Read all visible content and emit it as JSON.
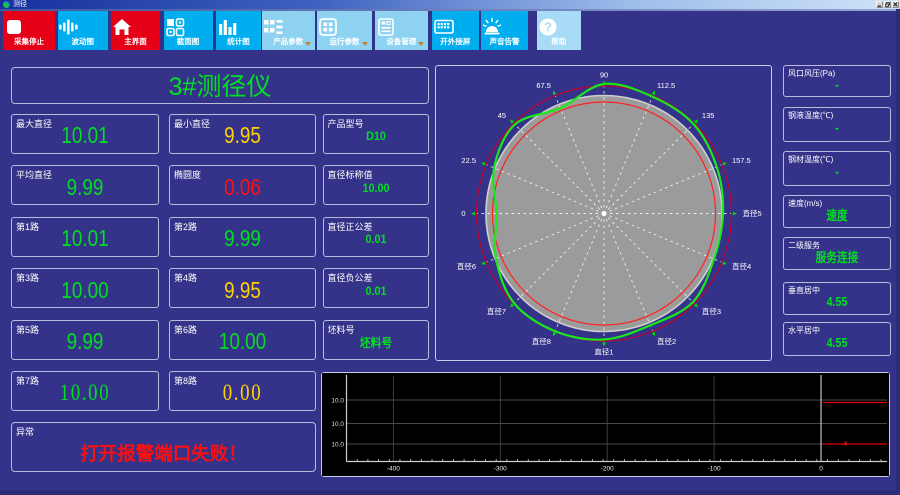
{
  "window": {
    "title": "测径",
    "controls": {
      "minimize": "_",
      "restore": "❐",
      "close": "✕"
    }
  },
  "toolbar": {
    "buttons": [
      {
        "label": "采集停止",
        "icon": "stop-icon",
        "style": "red"
      },
      {
        "label": "波动图",
        "icon": "wave-icon",
        "style": "cyan"
      },
      {
        "label": "主界面",
        "icon": "home-icon",
        "style": "red"
      },
      {
        "label": "截面图",
        "icon": "sections-icon",
        "style": "cyan"
      },
      {
        "label": "统计图",
        "icon": "barchart-icon",
        "style": "cyan"
      },
      {
        "label": "产品参数",
        "icon": "list-icon",
        "style": "pale",
        "dropdown": true
      },
      {
        "label": "运行参数",
        "icon": "grid-icon",
        "style": "pale",
        "dropdown": true
      },
      {
        "label": "设备管理",
        "icon": "device-icon",
        "style": "pale",
        "dropdown": true
      },
      {
        "label": "开外接屏",
        "icon": "monitor-icon",
        "style": "cyan"
      },
      {
        "label": "声音告警",
        "icon": "alarm-icon",
        "style": "cyan"
      },
      {
        "label": "帮助",
        "icon": "help-icon",
        "style": "pale2"
      }
    ],
    "dropdown_color": "#c2812e"
  },
  "gauge": {
    "title": "3#测径仪"
  },
  "measurements": [
    {
      "label": "最大直径",
      "value": "10.01",
      "color": "green"
    },
    {
      "label": "最小直径",
      "value": "9.95",
      "color": "yellow"
    },
    {
      "label": "平均直径",
      "value": "9.99",
      "color": "green"
    },
    {
      "label": "椭圆度",
      "value": "0.06",
      "color": "red"
    },
    {
      "label": "第1路",
      "value": "10.01",
      "color": "green"
    },
    {
      "label": "第2路",
      "value": "9.99",
      "color": "green"
    },
    {
      "label": "第3路",
      "value": "10.00",
      "color": "green"
    },
    {
      "label": "第4路",
      "value": "9.95",
      "color": "yellow"
    },
    {
      "label": "第5路",
      "value": "9.99",
      "color": "green"
    },
    {
      "label": "第6路",
      "value": "10.00",
      "color": "green"
    },
    {
      "label": "第7路",
      "value": "10.00",
      "color": "green",
      "serif": true
    },
    {
      "label": "第8路",
      "value": "0.00",
      "color": "yellow",
      "serif": true
    }
  ],
  "parameters": [
    {
      "label": "产品型号",
      "value": "D10"
    },
    {
      "label": "直径标称值",
      "value": "10.00"
    },
    {
      "label": "直径正公差",
      "value": "0.01"
    },
    {
      "label": "直径负公差",
      "value": "0.01"
    },
    {
      "label": "坯料号",
      "value": "坯料号"
    }
  ],
  "alarm": {
    "label": "异常",
    "value": "打开报警端口失败！"
  },
  "sidebar": [
    {
      "label": "风口风压(Pa)",
      "value": "-"
    },
    {
      "label": "钢液温度(℃)",
      "value": "-"
    },
    {
      "label": "钢材温度(℃)",
      "value": "-"
    },
    {
      "label": "速度(m/s)",
      "value": "速度"
    },
    {
      "label": "二级服务",
      "value": "服务连接"
    },
    {
      "label": "垂直居中",
      "value": "4.55"
    },
    {
      "label": "水平居中",
      "value": "4.55"
    }
  ],
  "colors": {
    "background": "#32328a",
    "card_border": "#b6bdda",
    "value_green": "#00df20",
    "value_yellow": "#ffd200",
    "value_red": "#ff1111",
    "button_red": "#e60017",
    "button_cyan": "#00aeef",
    "button_pale": "#8ed2f2"
  },
  "chart_data": [
    {
      "type": "polar-profile",
      "description": "cross-section profile of measured bar vs nominal circle",
      "angle_step_deg": 22.5,
      "spoke_labels": [
        {
          "angle_deg": 180,
          "text": "0"
        },
        {
          "angle_deg": 157.5,
          "text": "22.5"
        },
        {
          "angle_deg": 135,
          "text": "45"
        },
        {
          "angle_deg": 112.5,
          "text": "67.5"
        },
        {
          "angle_deg": 90,
          "text": "90"
        },
        {
          "angle_deg": 67.5,
          "text": "112.5"
        },
        {
          "angle_deg": 45,
          "text": "135"
        },
        {
          "angle_deg": 22.5,
          "text": "157.5"
        },
        {
          "angle_deg": 0,
          "text": "直径5"
        },
        {
          "angle_deg": 337.5,
          "text": "直径4"
        },
        {
          "angle_deg": 315,
          "text": "直径3"
        },
        {
          "angle_deg": 292.5,
          "text": "直径2"
        },
        {
          "angle_deg": 270,
          "text": "直径1"
        },
        {
          "angle_deg": 247.5,
          "text": "直径8"
        },
        {
          "angle_deg": 225,
          "text": "直径7"
        },
        {
          "angle_deg": 202.5,
          "text": "直径6"
        }
      ],
      "rings": [
        {
          "name": "section-fill",
          "radius": 118,
          "fill": "#9b9b9b",
          "stroke": "#cfcfcf"
        },
        {
          "name": "tolerance-inner",
          "radius": 111.5,
          "stroke": "#ff2222"
        },
        {
          "name": "tolerance-outer",
          "radius": 127.5,
          "stroke": "#c00030"
        }
      ],
      "profile": {
        "angles_deg": [
          0,
          22.5,
          45,
          67.5,
          90,
          112.5,
          135,
          157.5,
          180,
          202.5,
          225,
          247.5,
          270,
          292.5,
          315,
          337.5
        ],
        "radii": [
          119,
          122,
          126.5,
          126.5,
          129.5,
          114,
          126,
          119,
          107.5,
          117,
          127,
          127.5,
          126,
          121,
          125.5,
          119
        ],
        "color": "#1ae81a"
      },
      "spoke_color": "#ffffff",
      "marker_color": "#00dd00"
    },
    {
      "type": "line",
      "description": "diameter trend strip chart",
      "x_ticks": [
        -400,
        -300,
        -200,
        -100,
        0
      ],
      "x_range": [
        -444,
        63
      ],
      "y_gridline_labels": [
        "10.0",
        "10.0",
        "10.0"
      ],
      "zero_line_x": 0,
      "series": [
        {
          "name": "upper-trace",
          "color": "#dd0000",
          "points": [
            [
              0,
              "10.0-top"
            ],
            [
              63,
              "10.0-top"
            ]
          ]
        },
        {
          "name": "lower-trace",
          "color": "#dd0000",
          "points": [
            [
              0,
              "10.0-bottom"
            ],
            [
              63,
              "10.0-bottom"
            ]
          ],
          "marker_x": 23
        }
      ],
      "plot_background": "#000000",
      "axis_color": "#cfcfcf",
      "grid_color": "#3e3e3e"
    }
  ]
}
